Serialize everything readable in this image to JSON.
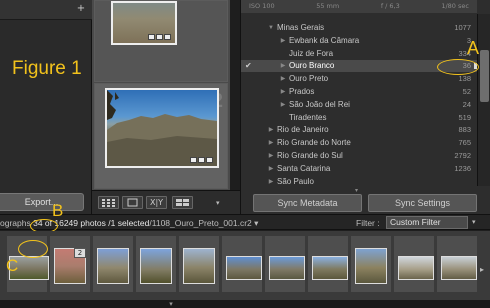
{
  "left_panel": {
    "plus_icon": "+",
    "figure_label": "Figure 1",
    "export_label": "Export..."
  },
  "grid": {
    "cell_index": "2"
  },
  "toolbar": {
    "compare_label": "X|Y",
    "dropdown_icon": "▾"
  },
  "histogram": {
    "iso": "ISO 100",
    "focal": "55 mm",
    "aperture": "f / 6,3",
    "shutter": "1/80 sec"
  },
  "folders": [
    {
      "label": "Minas Gerais",
      "count": "1077",
      "indent": 1,
      "expanded": true
    },
    {
      "label": "Ewbank da Câmara",
      "count": "3",
      "indent": 2,
      "expanded": false
    },
    {
      "label": "Juiz de Fora",
      "count": "334",
      "indent": 2,
      "expanded": null
    },
    {
      "label": "Ouro Branco",
      "count": "36",
      "indent": 2,
      "expanded": false,
      "selected": true,
      "checked": "✔"
    },
    {
      "label": "Ouro Preto",
      "count": "138",
      "indent": 2,
      "expanded": false
    },
    {
      "label": "Prados",
      "count": "52",
      "indent": 2,
      "expanded": false
    },
    {
      "label": "São João del Rei",
      "count": "24",
      "indent": 2,
      "expanded": false
    },
    {
      "label": "Tiradentes",
      "count": "519",
      "indent": 2,
      "expanded": null
    },
    {
      "label": "Rio de Janeiro",
      "count": "883",
      "indent": 1,
      "expanded": false
    },
    {
      "label": "Rio Grande do Norte",
      "count": "765",
      "indent": 1,
      "expanded": false
    },
    {
      "label": "Rio Grande do Sul",
      "count": "2792",
      "indent": 1,
      "expanded": false
    },
    {
      "label": "Santa Catarina",
      "count": "1236",
      "indent": 1,
      "expanded": false
    },
    {
      "label": "São Paulo",
      "count": "",
      "indent": 1,
      "expanded": false
    }
  ],
  "annotations": {
    "label_a": "A",
    "label_b": "B",
    "label_c": "C"
  },
  "sync": {
    "metadata_label": "Sync Metadata",
    "settings_label": "Sync Settings"
  },
  "info_bar": {
    "prefix": "ographs",
    "count_text": "34 of 16249 photos",
    "selected_text": "/1 selected",
    "filename": "/1108_Ouro_Preto_001.cr2",
    "chevron": "▾",
    "filter_label": "Filter :",
    "filter_value": "Custom Filter"
  },
  "filmstrip": {
    "stack_badge": "2",
    "scroll_right": "▸"
  },
  "bottom": {
    "arrow": "▾"
  },
  "colors": {
    "annotation": "#f2c21c",
    "selected_row": "#4a4a4a",
    "background": "#1e1e1e"
  },
  "icons": [
    "plus-icon",
    "grid-view-icon",
    "loupe-view-icon",
    "compare-view-icon",
    "survey-view-icon",
    "disclosure-triangle-icon",
    "checkmark-icon",
    "scroll-arrow-icon"
  ]
}
